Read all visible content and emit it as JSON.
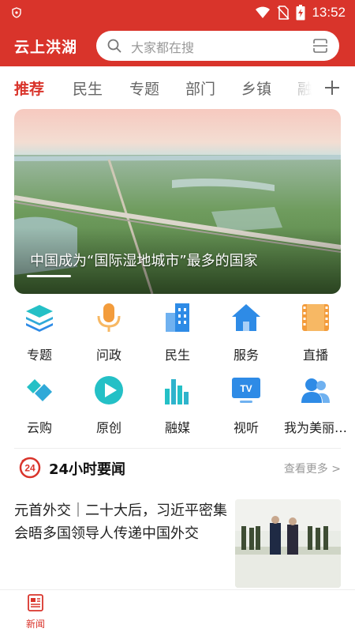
{
  "status_bar": {
    "time": "13:52"
  },
  "header": {
    "app_title": "云上洪湖"
  },
  "search": {
    "placeholder": "大家都在搜"
  },
  "tabs": [
    {
      "label": "推荐",
      "active": true
    },
    {
      "label": "民生"
    },
    {
      "label": "专题"
    },
    {
      "label": "部门"
    },
    {
      "label": "乡镇"
    },
    {
      "label": "融媒"
    }
  ],
  "banner": {
    "caption": "中国成为“国际湿地城市”最多的国家"
  },
  "icon_grid": [
    {
      "label": "专题",
      "icon": "layers-icon"
    },
    {
      "label": "问政",
      "icon": "microphone-icon"
    },
    {
      "label": "民生",
      "icon": "building-icon"
    },
    {
      "label": "服务",
      "icon": "home-icon"
    },
    {
      "label": "直播",
      "icon": "film-icon"
    },
    {
      "label": "云购",
      "icon": "handshake-icon"
    },
    {
      "label": "原创",
      "icon": "play-icon"
    },
    {
      "label": "融媒",
      "icon": "bar-chart-icon"
    },
    {
      "label": "视听",
      "icon": "tv-icon"
    },
    {
      "label": "我为美丽…",
      "icon": "people-icon"
    }
  ],
  "news_section": {
    "logo_text": "24",
    "title": "24小时要闻",
    "more_label": "查看更多 >"
  },
  "news": [
    {
      "title": "元首外交｜二十大后，习近平密集会晤多国领导人传递中国外交"
    }
  ],
  "bottom_nav": [
    {
      "label": "新闻",
      "active": true
    }
  ],
  "colors": {
    "brand_red": "#d9342b",
    "icon_blue": "#2e8be6",
    "icon_orange": "#f39c3c",
    "icon_teal": "#24c0c6"
  }
}
